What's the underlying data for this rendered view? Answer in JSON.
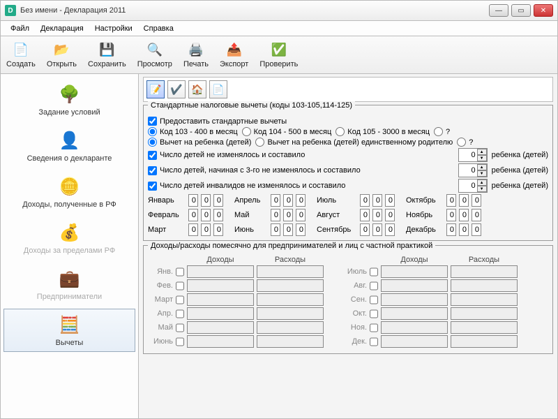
{
  "window": {
    "title": "Без имени - Декларация 2011"
  },
  "menu": {
    "file": "Файл",
    "decl": "Декларация",
    "settings": "Настройки",
    "help": "Справка"
  },
  "toolbar": {
    "create": "Создать",
    "open": "Открыть",
    "save": "Сохранить",
    "preview": "Просмотр",
    "print": "Печать",
    "export": "Экспорт",
    "check": "Проверить"
  },
  "sidebar": {
    "cond": "Задание условий",
    "declarant": "Сведения о декларанте",
    "income_rf": "Доходы, полученные в РФ",
    "income_abroad": "Доходы за пределами РФ",
    "entrepreneur": "Предприниматели",
    "deductions": "Вычеты"
  },
  "group1": {
    "title": "Стандартные налоговые вычеты (коды 103-105,114-125)",
    "provide": "Предоставить стандартные вычеты",
    "code103": "Код 103 - 400 в месяц",
    "code104": "Код 104 - 500 в месяц",
    "code105": "Код 105 - 3000 в месяц",
    "question": "?",
    "child1": "Вычет на ребенка (детей)",
    "child2": "Вычет на ребенка (детей) единственному родителю",
    "count_children": "Число детей не изменялось и составило",
    "count_from3": "Число детей, начиная с 3-го не изменялось и составило",
    "count_disabled": "Число детей инвалидов не изменялось и составило",
    "child_suffix": "ребенка (детей)",
    "spin_val": "0",
    "months": {
      "jan": "Январь",
      "feb": "Февраль",
      "mar": "Март",
      "apr": "Апрель",
      "may": "Май",
      "jun": "Июнь",
      "jul": "Июль",
      "aug": "Август",
      "sep": "Сентябрь",
      "oct": "Октябрь",
      "nov": "Ноябрь",
      "dec": "Декабрь"
    },
    "cell": "0"
  },
  "group2": {
    "title": "Доходы/расходы помесячно для предпринимателей и лиц с частной практикой",
    "income_hd": "Доходы",
    "expense_hd": "Расходы",
    "months": {
      "jan": "Янв.",
      "feb": "Фев.",
      "mar": "Март",
      "apr": "Апр.",
      "may": "Май",
      "jun": "Июнь",
      "jul": "Июль",
      "aug": "Авг.",
      "sep": "Сен.",
      "oct": "Окт.",
      "nov": "Ноя.",
      "dec": "Дек."
    }
  }
}
